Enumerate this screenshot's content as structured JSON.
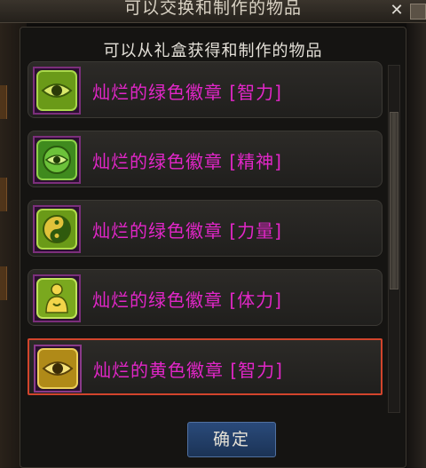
{
  "window": {
    "title": "可以交换和制作的物品",
    "close_glyph": "✕"
  },
  "dialog": {
    "subtitle": "可以从礼盒获得和制作的物品",
    "items": [
      {
        "label": "灿烂的绿色徽章 [智力]",
        "icon": "eye-emblem-icon",
        "color": "#7fbf1e"
      },
      {
        "label": "灿烂的绿色徽章 [精神]",
        "icon": "eye-circle-emblem-icon",
        "color": "#5ab52a"
      },
      {
        "label": "灿烂的绿色徽章 [力量]",
        "icon": "yin-yang-emblem-icon",
        "color": "#8fcf2a"
      },
      {
        "label": "灿烂的绿色徽章 [体力]",
        "icon": "figure-emblem-icon",
        "color": "#9ad22e"
      },
      {
        "label": "灿烂的黄色徽章 [智力]",
        "icon": "eye-emblem-icon",
        "color": "#d9b52a",
        "selected": true
      }
    ],
    "ok_label": "确定"
  },
  "colors": {
    "item_label": "#e226c8",
    "selected_border": "#d2442c",
    "ok_button": "#1b3356"
  }
}
